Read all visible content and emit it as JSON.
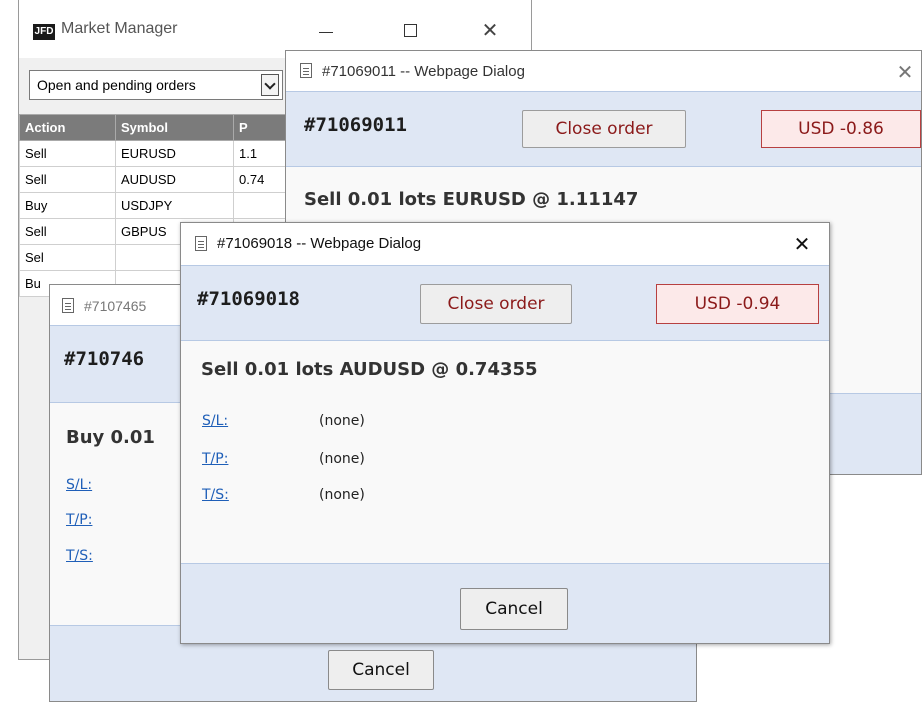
{
  "market_manager": {
    "logo_text": "JFD",
    "title": "Market Manager",
    "close_glyph": "✕",
    "filter_select": {
      "value": "Open and pending orders"
    },
    "table": {
      "headers": [
        "Action",
        "Symbol",
        "P"
      ],
      "rows": [
        [
          "Sell",
          "EURUSD",
          "1.1"
        ],
        [
          "Sell",
          "AUDUSD",
          "0.74"
        ],
        [
          "Buy",
          "USDJPY",
          ""
        ],
        [
          "Sell",
          "GBPUS",
          ""
        ],
        [
          "Sel",
          "",
          ""
        ],
        [
          "Bu",
          "",
          ""
        ]
      ]
    }
  },
  "dialog_71069011": {
    "title": "#71069011 -- Webpage Dialog",
    "close_glyph": "✕",
    "order_number": "#71069011",
    "close_order_label": "Close order",
    "pl_value": "USD -0.86",
    "summary": "Sell 0.01 lots EURUSD @ 1.11147"
  },
  "dialog_71074651": {
    "title": "#7107465",
    "order_number": "#710746",
    "summary": "Buy 0.01",
    "fields": [
      {
        "label": "S/L:"
      },
      {
        "label": "T/P:"
      },
      {
        "label": "T/S:"
      }
    ],
    "cancel_label": "Cancel"
  },
  "dialog_71069018": {
    "title": "#71069018 -- Webpage Dialog",
    "close_glyph": "✕",
    "order_number": "#71069018",
    "close_order_label": "Close order",
    "pl_value": "USD -0.94",
    "summary": "Sell 0.01 lots AUDUSD @ 0.74355",
    "fields": [
      {
        "label": "S/L:",
        "value": "(none)"
      },
      {
        "label": "T/P:",
        "value": "(none)"
      },
      {
        "label": "T/S:",
        "value": "(none)"
      }
    ],
    "cancel_label": "Cancel"
  },
  "colors": {
    "band_bg": "#dfe7f4",
    "pl_bg": "#fce9e9",
    "pl_border": "#b74040",
    "accent_text": "#8b1a1a",
    "link": "#1f5fb8",
    "table_header": "#7b7b7b"
  }
}
